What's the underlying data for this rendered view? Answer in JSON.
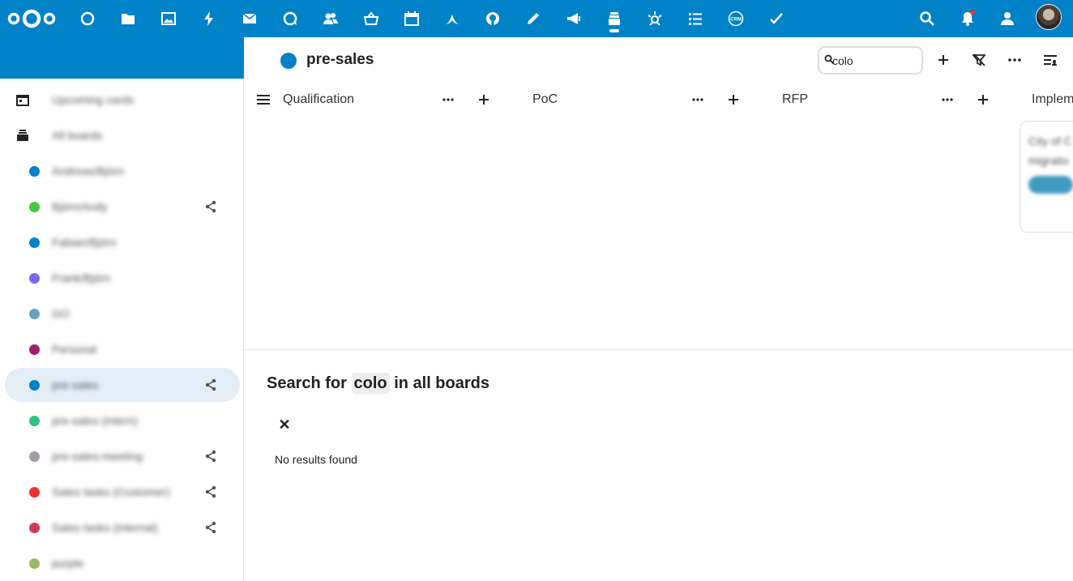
{
  "topbar": {
    "apps": [
      "dashboard-icon",
      "files-icon",
      "photos-icon",
      "activity-icon",
      "mail-icon",
      "talk-icon",
      "contacts-icon",
      "cospend-icon",
      "calendar-icon",
      "deck-sync-icon",
      "github-icon",
      "notes-icon",
      "announcements-icon",
      "deck-icon",
      "ai-icon",
      "tasks-icon",
      "crm-icon",
      "checkmark-icon"
    ],
    "crm_label": "CRM"
  },
  "sidebar": {
    "upcoming": "Upcoming cards",
    "all_boards": "All boards",
    "boards": [
      {
        "label": "Andreas/Björn",
        "color": "#0082c9",
        "shared": false
      },
      {
        "label": "Björn/Andy",
        "color": "#49c540",
        "shared": true
      },
      {
        "label": "Fabian/Björn",
        "color": "#0082c9",
        "shared": false
      },
      {
        "label": "Frank/Björn",
        "color": "#7b68ee",
        "shared": false
      },
      {
        "label": "GO",
        "color": "#6a9fc0",
        "shared": false
      },
      {
        "label": "Personal",
        "color": "#a0206e",
        "shared": false
      },
      {
        "label": "pre-sales",
        "color": "#0082c9",
        "shared": true,
        "active": true
      },
      {
        "label": "pre-sales (intern)",
        "color": "#2ec27e",
        "shared": false
      },
      {
        "label": "pre-sales-meeting",
        "color": "#a89ba9",
        "shared": true
      },
      {
        "label": "Sales tasks (Customer)",
        "color": "#e9322d",
        "shared": true
      },
      {
        "label": "Sales tasks (internal)",
        "color": "#d03b55",
        "shared": true
      },
      {
        "label": "purple",
        "color": "#9bb868",
        "shared": false
      }
    ]
  },
  "board": {
    "title": "pre-sales",
    "color": "#0082c9",
    "search_value": "colo",
    "columns": [
      "Qualification",
      "PoC",
      "RFP",
      "Implem"
    ]
  },
  "card": {
    "line1": "City of C",
    "line2": "migratio"
  },
  "search": {
    "prefix": "Search for",
    "term": "colo",
    "suffix": "in all boards",
    "close": "✕",
    "no_results": "No results found"
  }
}
